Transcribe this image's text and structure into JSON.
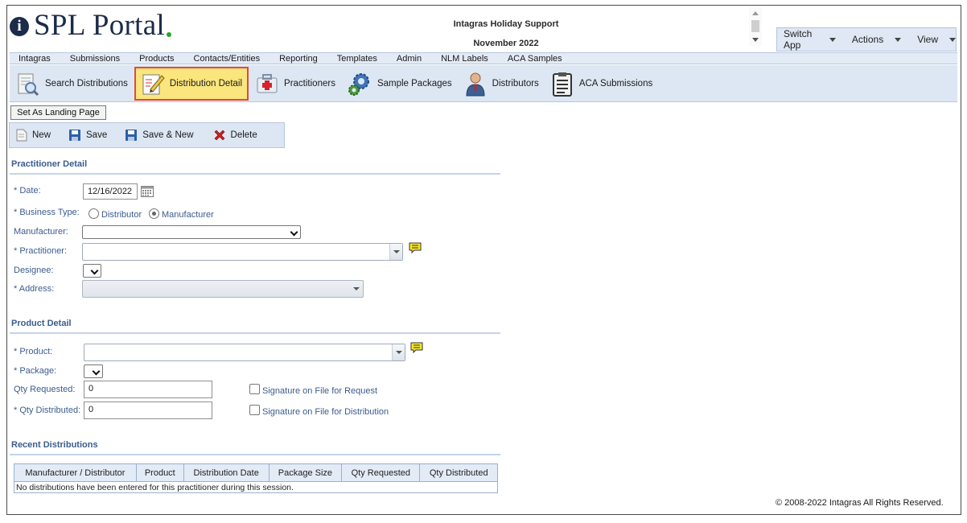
{
  "header": {
    "logo_text": "SPL Portal",
    "support_title": "Intagras Holiday Support",
    "support_date": "November 2022"
  },
  "topmenu": [
    {
      "label": "Switch App"
    },
    {
      "label": "Actions"
    },
    {
      "label": "View"
    }
  ],
  "nav": [
    "Intagras",
    "Submissions",
    "Products",
    "Contacts/Entities",
    "Reporting",
    "Templates",
    "Admin",
    "NLM Labels",
    "ACA Samples"
  ],
  "toolbar": {
    "search_distributions": "Search Distributions",
    "distribution_detail": "Distribution Detail",
    "practitioners": "Practitioners",
    "sample_packages": "Sample Packages",
    "distributors": "Distributors",
    "aca_submissions": "ACA Submissions"
  },
  "landing_button": "Set As Landing Page",
  "actions": {
    "new": "New",
    "save": "Save",
    "save_new": "Save & New",
    "delete": "Delete"
  },
  "practitioner_section": {
    "title": "Practitioner Detail",
    "date_label": "* Date:",
    "date_value": "12/16/2022",
    "business_type_label": "* Business Type:",
    "business_type_options": [
      "Distributor",
      "Manufacturer"
    ],
    "business_type_selected": "Manufacturer",
    "manufacturer_label": "Manufacturer:",
    "practitioner_label": "* Practitioner:",
    "designee_label": "Designee:",
    "address_label": "* Address:"
  },
  "product_section": {
    "title": "Product Detail",
    "product_label": "* Product:",
    "package_label": "* Package:",
    "qty_requested_label": "Qty Requested:",
    "qty_requested_value": "0",
    "qty_distributed_label": "* Qty Distributed:",
    "qty_distributed_value": "0",
    "sig_request_label": "Signature on File for Request",
    "sig_distribution_label": "Signature on File for Distribution"
  },
  "recent_section": {
    "title": "Recent Distributions",
    "columns": [
      "Manufacturer / Distributor",
      "Product",
      "Distribution Date",
      "Package Size",
      "Qty Requested",
      "Qty Distributed"
    ],
    "empty_message": "No distributions have been entered for this practitioner during this session."
  },
  "footer": {
    "copyright": "© 2008-2022 Intagras All Rights Reserved."
  },
  "colors": {
    "brand_navy": "#1c2b4a",
    "brand_green": "#2aa52a",
    "label_blue": "#3b5c8e",
    "toolbar_bg": "#dde7f3",
    "active_tab_bg": "#fbe57d",
    "active_tab_border": "#e04a3a"
  }
}
